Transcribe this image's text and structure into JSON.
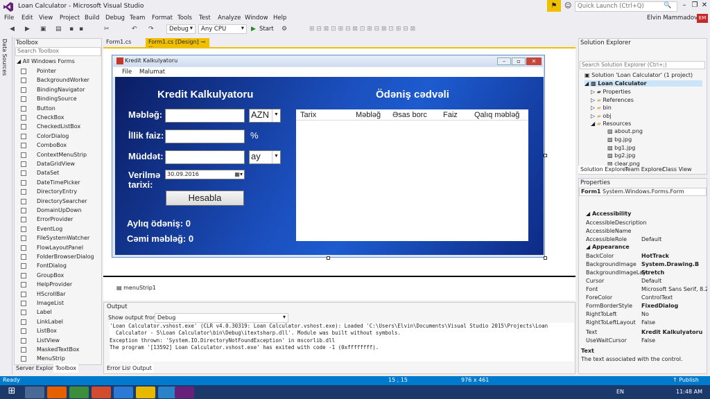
{
  "window": {
    "title": "Loan Calculator - Microsoft Visual Studio",
    "quick_launch_placeholder": "Quick Launch (Ctrl+Q)",
    "user": "Elvin Mammadov",
    "user_initials": "EM"
  },
  "menu": [
    "File",
    "Edit",
    "View",
    "Project",
    "Build",
    "Debug",
    "Team",
    "Format",
    "Tools",
    "Test",
    "Analyze",
    "Window",
    "Help"
  ],
  "toolbar": {
    "config": "Debug",
    "platform": "Any CPU",
    "start_label": "Start"
  },
  "left_strip": {
    "label": "Data Sources"
  },
  "toolbox": {
    "title": "Toolbox",
    "search_placeholder": "Search Toolbox",
    "group": "All Windows Forms",
    "items": [
      "Pointer",
      "BackgroundWorker",
      "BindingNavigator",
      "BindingSource",
      "Button",
      "CheckBox",
      "CheckedListBox",
      "ColorDialog",
      "ComboBox",
      "ContextMenuStrip",
      "DataGridView",
      "DataSet",
      "DateTimePicker",
      "DirectoryEntry",
      "DirectorySearcher",
      "DomainUpDown",
      "ErrorProvider",
      "EventLog",
      "FileSystemWatcher",
      "FlowLayoutPanel",
      "FolderBrowserDialog",
      "FontDialog",
      "GroupBox",
      "HelpProvider",
      "HScrollBar",
      "ImageList",
      "Label",
      "LinkLabel",
      "ListBox",
      "ListView",
      "MaskedTextBox",
      "MenuStrip"
    ],
    "bottom_tabs": [
      "Server Explorer",
      "Toolbox"
    ]
  },
  "doc_tabs": [
    "Form1.cs",
    "Form1.cs [Design]"
  ],
  "form": {
    "title": "Kredit Kalkulyatoru",
    "menu": [
      "File",
      "Malumat"
    ],
    "heading_left": "Kredit Kalkulyatoru",
    "heading_right": "Ödəniş cədvəli",
    "label_amount": "Məbləğ:",
    "label_rate": "İllik faiz:",
    "label_term": "Müddət:",
    "label_date_1": "Verilmə",
    "label_date_2": "tarixi:",
    "currency": "AZN",
    "percent": "%",
    "term_unit": "ay",
    "date_value": "30.09.2016",
    "button": "Hesabla",
    "monthly": "Aylıq ödəniş: 0",
    "total": "Cəmi məbləğ: 0",
    "grid_columns": [
      "Tarix",
      "Məbləğ",
      "Əsas borc",
      "Faiz",
      "Qalıq məbləğ"
    ],
    "tray_item": "menuStrip1"
  },
  "output": {
    "title": "Output",
    "show_from_label": "Show output from:",
    "show_from_value": "Debug",
    "lines": [
      "'Loan Calculator.vshost.exe' (CLR v4.0.30319: Loan Calculator.vshost.exe): Loaded 'C:\\Users\\Elvin\\Documents\\Visual Studio 2015\\Projects\\Loan",
      "  Calculator - 5\\Loan Calculator\\bin\\Debug\\itextsharp.dll'. Module was built without symbols.",
      "Exception thrown: 'System.IO.DirectoryNotFoundException' in mscorlib.dll",
      "The program '[13592] Loan Calculator.vshost.exe' has exited with code -1 (0xffffffff)."
    ],
    "bottom_tabs": [
      "Error List",
      "Output"
    ]
  },
  "solution_explorer": {
    "title": "Solution Explorer",
    "search_placeholder": "Search Solution Explorer (Ctrl+;)",
    "solution": "Solution 'Loan Calculator' (1 project)",
    "project": "Loan Calculator",
    "nodes": [
      "Properties",
      "References",
      "bin",
      "obj",
      "Resources"
    ],
    "files": [
      "about.png",
      "bg.jpg",
      "bg1.jpg",
      "bg2.jpg",
      "clear.png"
    ],
    "bottom_tabs": [
      "Solution Explorer",
      "Team Explorer",
      "Class View"
    ]
  },
  "properties": {
    "title": "Properties",
    "object": "Form1",
    "object_type": "System.Windows.Forms.Form",
    "cat_accessibility": "Accessibility",
    "cat_appearance": "Appearance",
    "rows": [
      {
        "name": "AccessibleDescription",
        "value": ""
      },
      {
        "name": "AccessibleName",
        "value": ""
      },
      {
        "name": "AccessibleRole",
        "value": "Default"
      },
      {
        "name": "BackColor",
        "value": "HotTrack"
      },
      {
        "name": "BackgroundImage",
        "value": "System.Drawing.B"
      },
      {
        "name": "BackgroundImageLayo",
        "value": "Stretch"
      },
      {
        "name": "Cursor",
        "value": "Default"
      },
      {
        "name": "Font",
        "value": "Microsoft Sans Serif, 8.25"
      },
      {
        "name": "ForeColor",
        "value": "ControlText"
      },
      {
        "name": "FormBorderStyle",
        "value": "FixedDialog"
      },
      {
        "name": "RightToLeft",
        "value": "No"
      },
      {
        "name": "RightToLeftLayout",
        "value": "False"
      },
      {
        "name": "Text",
        "value": "Kredit Kalkulyatoru"
      },
      {
        "name": "UseWaitCursor",
        "value": "False"
      }
    ],
    "desc_title": "Text",
    "desc_text": "The text associated with the control."
  },
  "status": {
    "ready": "Ready",
    "position": "15 , 15",
    "size": "976 x 461",
    "publish": "Publish"
  },
  "taskbar": {
    "lang": "EN",
    "time": "11:48 AM"
  },
  "colors": {
    "accent": "#007acc",
    "highlight": "#f0c000",
    "form_blue": "#1b4fbd"
  }
}
